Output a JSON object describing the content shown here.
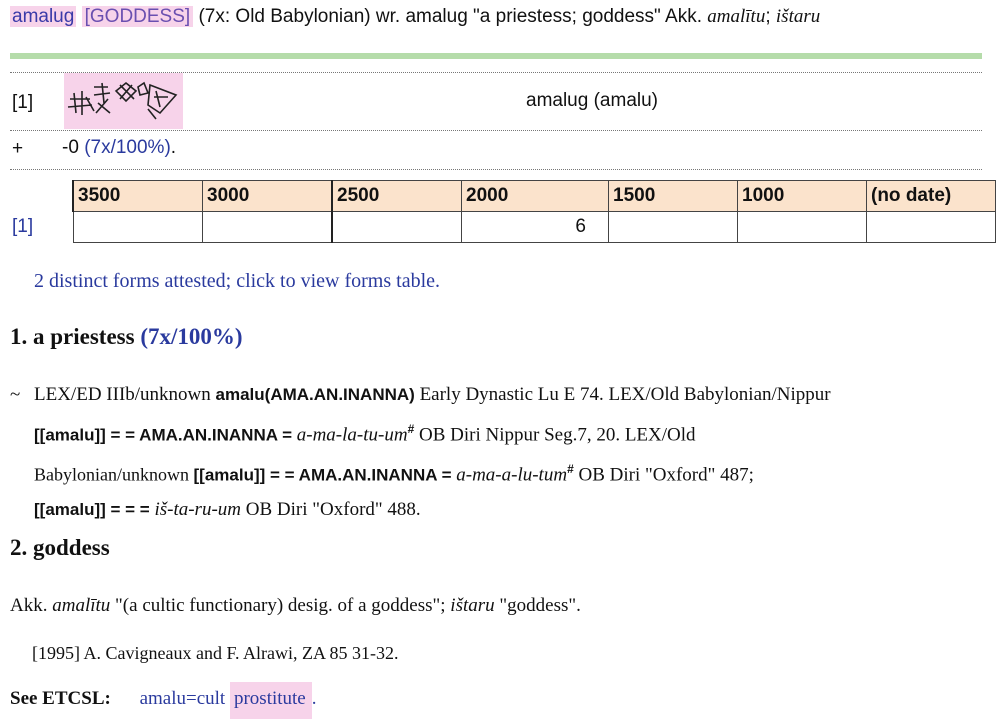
{
  "header": {
    "headword": "amalug",
    "domain": "[GODDESS]",
    "info": " (7x: Old Babylonian) wr. amalug \"a priestess; goddess\" Akk. ",
    "akk1": "amalītu",
    "sep": "; ",
    "akk2": "ištaru"
  },
  "forms": {
    "row_label": "[1]",
    "cuneiform_icon": "cuneiform-sign",
    "form_name": "amalug (amalu)",
    "plus_label": "+",
    "stat_prefix": "-0 ",
    "stat_count": "(7x/100%)",
    "stat_suffix": "."
  },
  "dates_table": {
    "headers": [
      "3500",
      "3000",
      "2500",
      "2000",
      "1500",
      "1000",
      "(no date)"
    ],
    "row_label": "[1]",
    "values": [
      "",
      "",
      "",
      "6",
      "",
      "",
      ""
    ]
  },
  "forms_link": "2 distinct forms attested; click to view forms table.",
  "senses": [
    {
      "title": "1. a priestess ",
      "pct": "(7x/100%)"
    },
    {
      "title": "2. goddess",
      "pct": ""
    }
  ],
  "lex": {
    "tilde": "~",
    "l1a": "LEX/ED IIIb/unknown ",
    "l1b": "amalu(AMA.AN.INANNA)",
    "l1c": " Early Dynastic Lu E 74.   LEX/Old Babylonian/Nippur",
    "l2a": "[[amalu]] = = AMA.AN.INANNA = ",
    "l2b": "a-ma-la-tu-um",
    "l2c": "#",
    "l2d": " OB Diri Nippur Seg.7, 20.   LEX/Old",
    "l3a": "Babylonian/unknown ",
    "l3b": "[[amalu]] = = AMA.AN.INANNA = ",
    "l3c": "a-ma-a-lu-tum",
    "l3d": "#",
    "l3e": " OB Diri \"Oxford\" 487;",
    "l4a": "[[amalu]] = = = ",
    "l4b": "iš-ta-ru-um",
    "l4c": " OB Diri \"Oxford\" 488."
  },
  "akk_line": {
    "a": "Akk. ",
    "b": "amalītu",
    "c": " \"(a cultic functionary) desig. of a goddess\"; ",
    "d": "ištaru",
    "e": " \"goddess\"."
  },
  "reference": "[1995] A. Cavigneaux and F. Alrawi, ZA 85 31-32.",
  "etcsl": {
    "label": "See ETCSL:",
    "link_a": "amalu=cult ",
    "link_b": "prostitute",
    "link_c": "."
  }
}
